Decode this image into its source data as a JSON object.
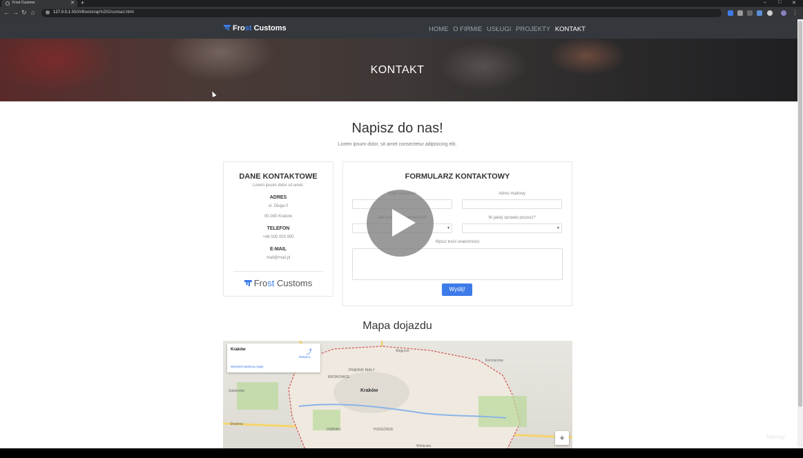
{
  "browser": {
    "tab_title": "Frost Customs",
    "tab_close": "✕",
    "new_tab": "+",
    "url_host": "127.0.0.1",
    "url_path": ":5500/Bootstrap%202/contact.html",
    "win_min": "–",
    "win_max": "□",
    "win_close": "✕"
  },
  "site": {
    "brand_prefix": "Fro",
    "brand_accent": "st",
    "brand_suffix": " Customs",
    "menu": [
      "HOME",
      "O FIRMIE",
      "USŁUGI",
      "PROJEKTY",
      "KONTAKT"
    ],
    "active_menu": "KONTAKT",
    "accent_color": "#3d7be8"
  },
  "hero": {
    "title": "KONTAKT"
  },
  "section": {
    "title": "Napisz do nas!",
    "subtitle": "Lorem ipsum dolor, sit amet consectetur adipisicing elit."
  },
  "contact": {
    "heading": "DANE KONTAKTOWE",
    "sub": "Lorem ipsum dolor sit amet.",
    "address_label": "ADRES",
    "address_line1": "ul. Długa 0",
    "address_line2": "00-000 Kraków",
    "phone_label": "TELEFON",
    "phone": "+48 000 000 000",
    "email_label": "E-MAIL",
    "email": "mail@mail.pl",
    "logo_prefix": "Fro",
    "logo_accent": "st",
    "logo_suffix": " Customs"
  },
  "form": {
    "heading": "FORMULARZ KONTAKTOWY",
    "name_label": "Imię i nazwisko",
    "email_label": "Adres mailowy",
    "car_label": "Jaki posiadasz samochód?",
    "topic_label": "W jakiej sprawie piszesz?",
    "message_label": "Wpisz treść wiadomości",
    "send": "Wyślij!"
  },
  "map": {
    "title": "Mapa dojazdu",
    "info_title": "Kraków",
    "info_link": "Wyświetl większą mapę",
    "directions": "Wskazó...",
    "city_label": "Kraków",
    "labels": [
      "PRĄDNIK BIAŁY",
      "BRONOWICE",
      "DĘBNIKI",
      "PODGÓRZE",
      "Węgrzce",
      "Kocmyrzów",
      "Wieliczka",
      "Zabierzów",
      "Skawina"
    ],
    "zoom_in": "+"
  },
  "watermark": "Udemy"
}
